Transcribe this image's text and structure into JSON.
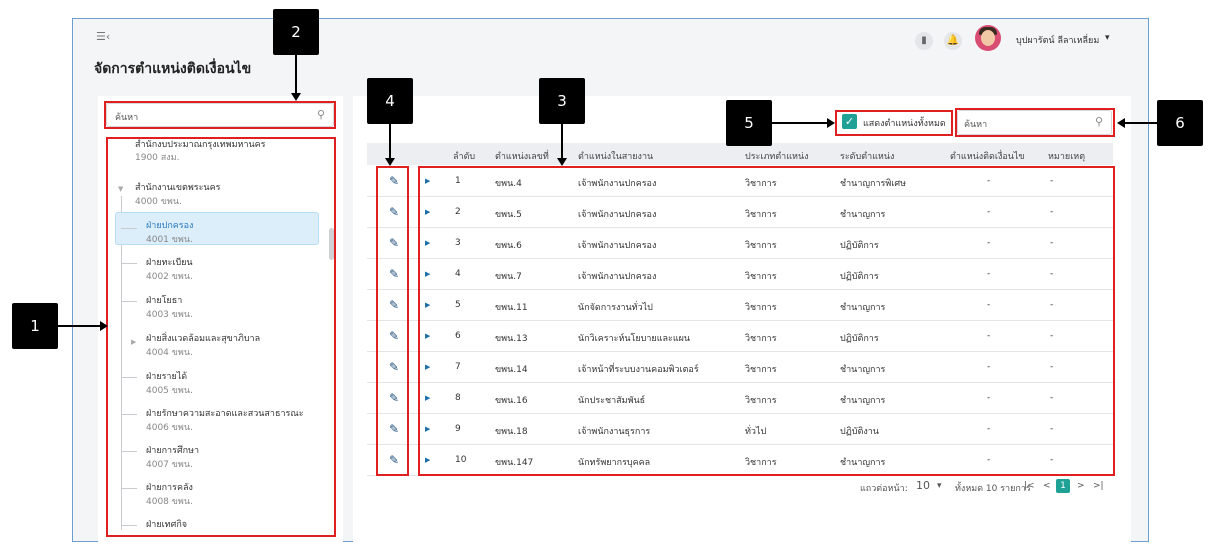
{
  "app": {
    "menu_icon": "menu-collapse-icon",
    "page_title": "จัดการตำแหน่งติดเงื่อนไข",
    "user_name": "บุปผารัตน์ ลีลาเหลี่ยม",
    "user_caret": "▾",
    "topbar_icons": [
      "book-icon",
      "bell-icon"
    ]
  },
  "tree": {
    "search_placeholder": "ค้นหา",
    "items": [
      {
        "name": "สำนักงบประมาณกรุงเทพมหานคร",
        "code": "1900 สงม."
      },
      {
        "name": "สำนักงานเขตพระนคร",
        "code": "4000 ขพน.",
        "expanded": true
      },
      {
        "name": "ฝ่ายปกครอง",
        "code": "4001 ขพน.",
        "selected": true
      },
      {
        "name": "ฝ่ายทะเบียน",
        "code": "4002 ขพน."
      },
      {
        "name": "ฝ่ายโยธา",
        "code": "4003 ขพน."
      },
      {
        "name": "ฝ่ายสิ่งแวดล้อมและสุขาภิบาล",
        "code": "4004 ขพน.",
        "has_children": true
      },
      {
        "name": "ฝ่ายรายได้",
        "code": "4005 ขพน."
      },
      {
        "name": "ฝ่ายรักษาความสะอาดและสวนสาธารณะ",
        "code": "4006 ขพน."
      },
      {
        "name": "ฝ่ายการศึกษา",
        "code": "4007 ขพน."
      },
      {
        "name": "ฝ่ายการคลัง",
        "code": "4008 ขพน."
      },
      {
        "name": "ฝ่ายเทศกิจ",
        "code": ""
      }
    ]
  },
  "table": {
    "show_all_label": "แสดงตำแหน่งทั้งหมด",
    "show_all_checked": true,
    "search_placeholder": "ค้นหา",
    "headers": [
      "ลำดับ",
      "ตำแหน่งเลขที่",
      "ตำแหน่งในสายงาน",
      "ประเภทตำแหน่ง",
      "ระดับตำแหน่ง",
      "ตำแหน่งติดเงื่อนไข",
      "หมายเหตุ"
    ],
    "rows": [
      {
        "no": "1",
        "pos_no": "ขพน.4",
        "title": "เจ้าพนักงานปกครอง",
        "type": "วิชาการ",
        "level": "ชำนาญการพิเศษ",
        "cond": "-",
        "note": "-"
      },
      {
        "no": "2",
        "pos_no": "ขพน.5",
        "title": "เจ้าพนักงานปกครอง",
        "type": "วิชาการ",
        "level": "ชำนาญการ",
        "cond": "-",
        "note": "-"
      },
      {
        "no": "3",
        "pos_no": "ขพน.6",
        "title": "เจ้าพนักงานปกครอง",
        "type": "วิชาการ",
        "level": "ปฏิบัติการ",
        "cond": "-",
        "note": "-"
      },
      {
        "no": "4",
        "pos_no": "ขพน.7",
        "title": "เจ้าพนักงานปกครอง",
        "type": "วิชาการ",
        "level": "ปฏิบัติการ",
        "cond": "-",
        "note": "-"
      },
      {
        "no": "5",
        "pos_no": "ขพน.11",
        "title": "นักจัดการงานทั่วไป",
        "type": "วิชาการ",
        "level": "ชำนาญการ",
        "cond": "-",
        "note": "-"
      },
      {
        "no": "6",
        "pos_no": "ขพน.13",
        "title": "นักวิเคราะห์นโยบายและแผน",
        "type": "วิชาการ",
        "level": "ปฏิบัติการ",
        "cond": "-",
        "note": "-"
      },
      {
        "no": "7",
        "pos_no": "ขพน.14",
        "title": "เจ้าหน้าที่ระบบงานคอมพิวเตอร์",
        "type": "วิชาการ",
        "level": "ชำนาญการ",
        "cond": "-",
        "note": "-"
      },
      {
        "no": "8",
        "pos_no": "ขพน.16",
        "title": "นักประชาสัมพันธ์",
        "type": "วิชาการ",
        "level": "ชำนาญการ",
        "cond": "-",
        "note": "-"
      },
      {
        "no": "9",
        "pos_no": "ขพน.18",
        "title": "เจ้าพนักงานธุรการ",
        "type": "ทั่วไป",
        "level": "ปฏิบัติงาน",
        "cond": "-",
        "note": "-"
      },
      {
        "no": "10",
        "pos_no": "ขพน.147",
        "title": "นักทรัพยากรบุคคล",
        "type": "วิชาการ",
        "level": "ชำนาญการ",
        "cond": "-",
        "note": "-"
      }
    ]
  },
  "pagination": {
    "rows_per_page_label": "แถวต่อหน้า:",
    "rows_per_page": "10",
    "total_label": "ทั้งหมด 10 รายการ",
    "first": "|<",
    "prev": "<",
    "current_page": "1",
    "next": ">",
    "last": ">|"
  },
  "callouts": [
    "1",
    "2",
    "3",
    "4",
    "5",
    "6"
  ],
  "colors": {
    "accent": "#1fa196",
    "highlight_box": "#e02020",
    "selected_row_bg": "#dbeefa",
    "frame_border": "#6a9fcf"
  }
}
